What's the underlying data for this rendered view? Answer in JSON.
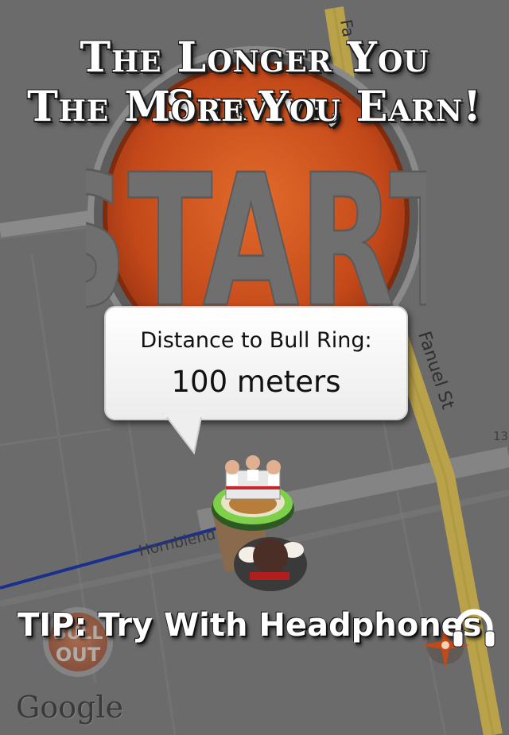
{
  "headline": {
    "line1": "The Longer You Survive,",
    "line2": "The More You Earn!"
  },
  "start_button": {
    "label": "START",
    "icon": "start-button"
  },
  "map": {
    "street_top": "Fa",
    "street_right": "Fanuel St",
    "street_left": "Hornblend",
    "house_number": "13",
    "attribution": "Google"
  },
  "distance_bubble": {
    "line1": "Distance to Bull Ring:",
    "line2": "100 meters"
  },
  "tip": {
    "text": "TIP: Try With Headphones",
    "icon": "headphones-icon"
  },
  "bull_out_button": {
    "line1": "BULL",
    "line2": "OUT"
  },
  "colors": {
    "start_orange": "#d9531b",
    "route_blue": "#1b2f8f",
    "road_yellow": "#b9a24a"
  }
}
